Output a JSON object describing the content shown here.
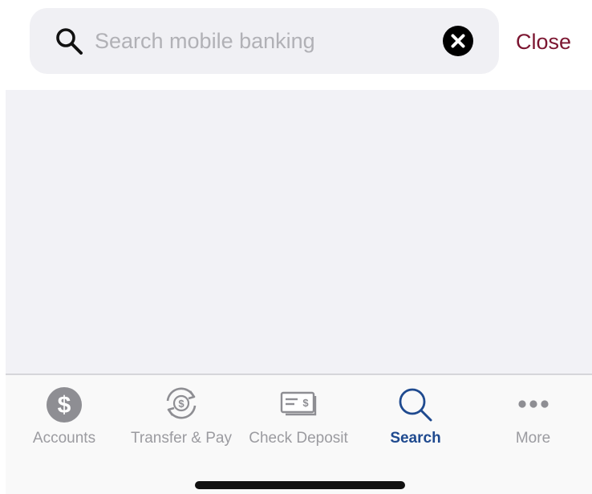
{
  "search": {
    "placeholder": "Search mobile banking",
    "value": "",
    "close_label": "Close"
  },
  "tabs": [
    {
      "id": "accounts",
      "label": "Accounts",
      "icon": "dollar-circle-icon",
      "active": false
    },
    {
      "id": "transfer-pay",
      "label": "Transfer & Pay",
      "icon": "transfer-arrows-icon",
      "active": false
    },
    {
      "id": "check-deposit",
      "label": "Check Deposit",
      "icon": "check-icon",
      "active": false
    },
    {
      "id": "search",
      "label": "Search",
      "icon": "search-icon",
      "active": true
    },
    {
      "id": "more",
      "label": "More",
      "icon": "more-dots-icon",
      "active": false
    }
  ],
  "colors": {
    "accent": "#7b1530",
    "active_tab": "#1f4a8f",
    "inactive_tab": "#9b9ba0",
    "search_bg": "#f0f0f4",
    "content_bg": "#f2f2f6"
  }
}
